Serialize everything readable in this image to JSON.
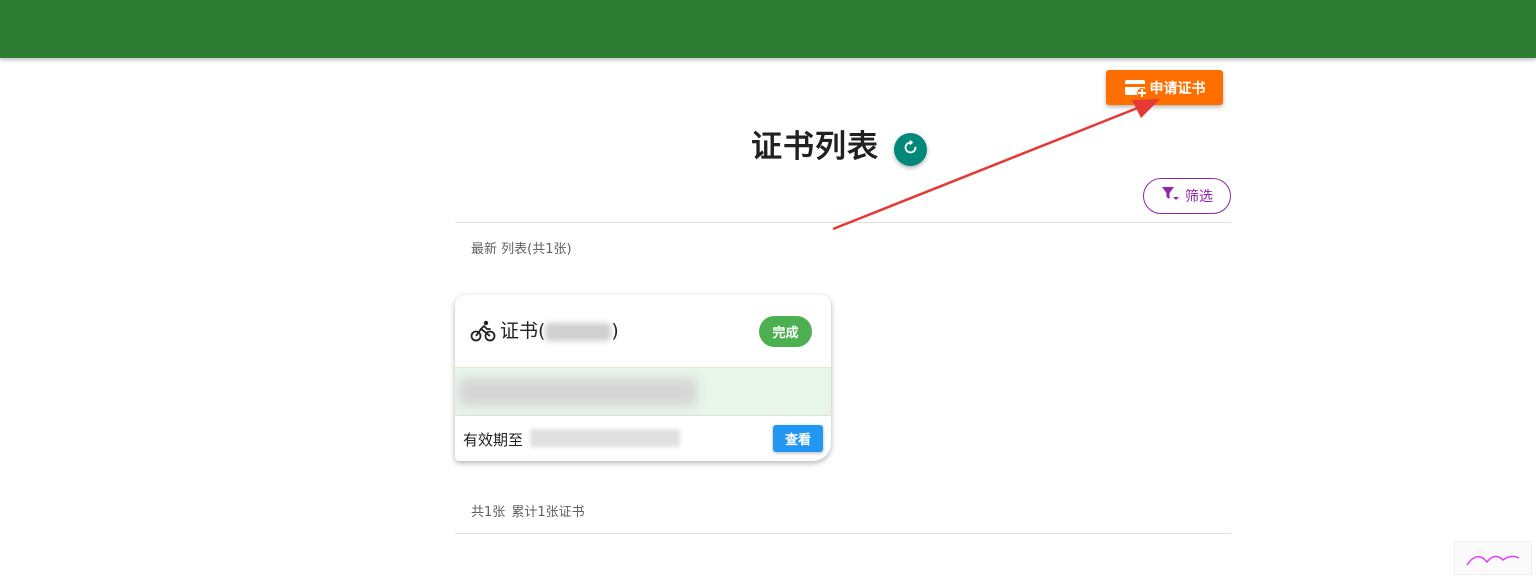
{
  "header": {
    "apply_label": "申请证书"
  },
  "main": {
    "title": "证书列表",
    "filter_label": "筛选",
    "list_header": "最新 列表(共1张)",
    "summary": "共1张 累计1张证书"
  },
  "card": {
    "name_prefix": "证书(",
    "name_suffix": ")",
    "status": "完成",
    "valid_label": "有效期至",
    "view_label": "查看"
  },
  "colors": {
    "topbar": "#2e7d32",
    "apply_button": "#ff6f00",
    "refresh_button": "#00897b",
    "filter_accent": "#8e24aa",
    "status_complete": "#4caf50",
    "view_button": "#2196f3",
    "annotation_arrow": "#e53935"
  },
  "icons": {
    "apply": "card-plus-icon",
    "refresh": "refresh-icon",
    "filter": "filter-icon",
    "cert": "bicycle-icon"
  }
}
